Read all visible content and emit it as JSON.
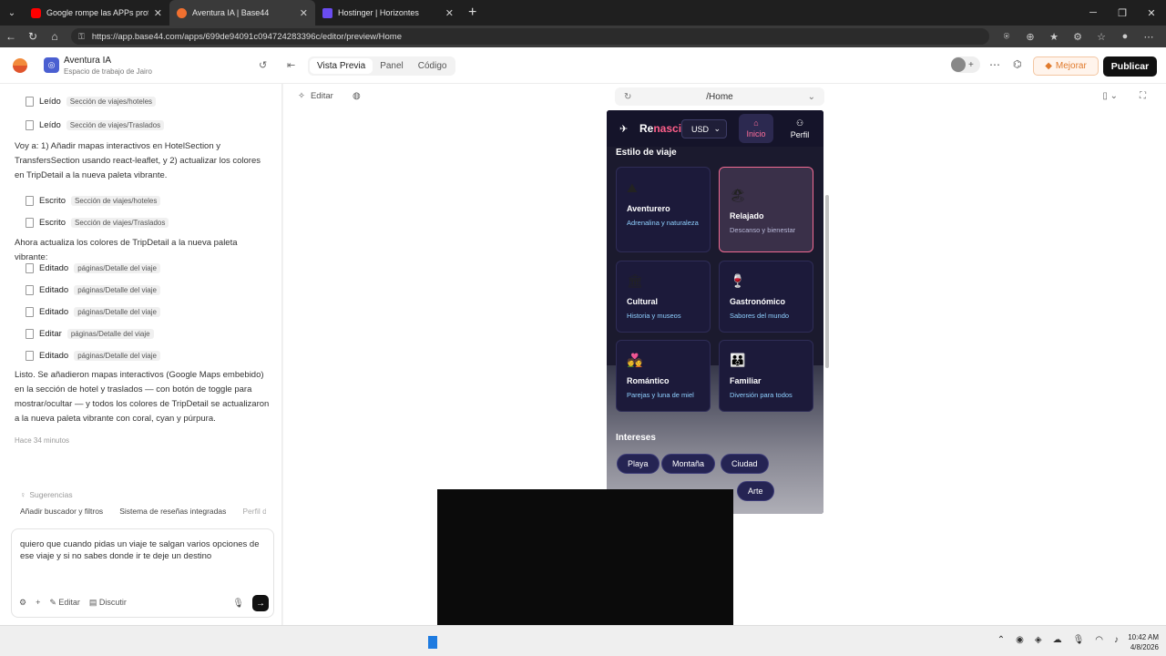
{
  "browser": {
    "tabs": [
      {
        "label": "Google rompe las APPs profesional",
        "color": "#ff0000",
        "active": false
      },
      {
        "label": "Aventura IA | Base44",
        "color": "#f07030",
        "active": true
      },
      {
        "label": "Hostinger | Horizontes",
        "color": "#6a4cf0",
        "active": false
      }
    ],
    "new_tab": "+",
    "url": "https://app.base44.com/apps/699de94091c094724283396c/editor/preview/Home"
  },
  "app": {
    "project_title": "Aventura IA",
    "project_sub": "Espacio de trabajo de Jairo",
    "view_tabs": [
      "Vista Previa",
      "Panel",
      "Código"
    ],
    "mejorar": "Mejorar",
    "publicar": "Publicar"
  },
  "chat": {
    "steps_a": [
      {
        "verb": "Leído",
        "chip": "Sección de viajes/hoteles"
      },
      {
        "verb": "Leído",
        "chip": "Sección de viajes/Traslados"
      }
    ],
    "msg1": "Voy a: 1) Añadir mapas interactivos en HotelSection y TransfersSection usando react-leaflet, y 2) actualizar los colores en TripDetail a la nueva paleta vibrante.",
    "steps_b": [
      {
        "verb": "Escrito",
        "chip": "Sección de viajes/hoteles"
      },
      {
        "verb": "Escrito",
        "chip": "Sección de viajes/Traslados"
      }
    ],
    "msg2": "Ahora actualiza los colores de TripDetail a la nueva paleta vibrante:",
    "steps_c": [
      {
        "verb": "Editado",
        "chip": "páginas/Detalle del viaje"
      },
      {
        "verb": "Editado",
        "chip": "páginas/Detalle del viaje"
      },
      {
        "verb": "Editado",
        "chip": "páginas/Detalle del viaje"
      },
      {
        "verb": "Editar",
        "chip": "páginas/Detalle del viaje"
      },
      {
        "verb": "Editado",
        "chip": "páginas/Detalle del viaje"
      }
    ],
    "msg3": "Listo. Se añadieron mapas interactivos (Google Maps embebido) en la sección de hotel y traslados — con botón de toggle para mostrar/ocultar — y todos los colores de TripDetail se actualizaron a la nueva paleta vibrante con coral, cyan y púrpura.",
    "time": "Hace 34 minutos",
    "suggestions_label": "Sugerencias",
    "suggestions": [
      "Añadir buscador y filtros",
      "Sistema de reseñas integradas",
      "Perfil de"
    ],
    "composer_text": "quiero que cuando pidas un viaje te salgan varios opciones de ese viaje y si no sabes donde ir te deje un destino",
    "editar": "Editar",
    "discutir": "Discutir"
  },
  "preview": {
    "editar": "Editar",
    "route": "/Home",
    "phone": {
      "brand_a": "Re",
      "brand_b": "nasci",
      "currency": "USD",
      "nav_inicio": "Inicio",
      "nav_perfil": "Perfil",
      "section_style": "Estilo de viaje",
      "cards": [
        {
          "icon": "mountain-icon",
          "glyph": "⛰",
          "title": "Aventurero",
          "desc": "Adrenalina y naturaleza",
          "selected": false
        },
        {
          "icon": "beach-icon",
          "glyph": "🏖",
          "title": "Relajado",
          "desc": "Descanso y bienestar",
          "selected": true
        },
        {
          "icon": "museum-icon",
          "glyph": "🏛",
          "title": "Cultural",
          "desc": "Historia y museos",
          "selected": false
        },
        {
          "icon": "wine-icon",
          "glyph": "🍷",
          "title": "Gastronómico",
          "desc": "Sabores del mundo",
          "selected": false
        },
        {
          "icon": "couple-icon",
          "glyph": "💑",
          "title": "Romántico",
          "desc": "Parejas y luna de miel",
          "selected": false
        },
        {
          "icon": "family-icon",
          "glyph": "👪",
          "title": "Familiar",
          "desc": "Diversión para todos",
          "selected": false
        }
      ],
      "section_interests": "Intereses",
      "interests": [
        "Playa",
        "Montaña",
        "Ciudad",
        "Arte"
      ]
    }
  },
  "taskbar": {
    "time": "10:42 AM",
    "date": "4/8/2026"
  },
  "colors": {
    "accent_coral": "#ff5f8a",
    "cyan": "#8fd0ff",
    "navy": "#1b1a2e",
    "mejorar_orange": "#e07a2c"
  }
}
